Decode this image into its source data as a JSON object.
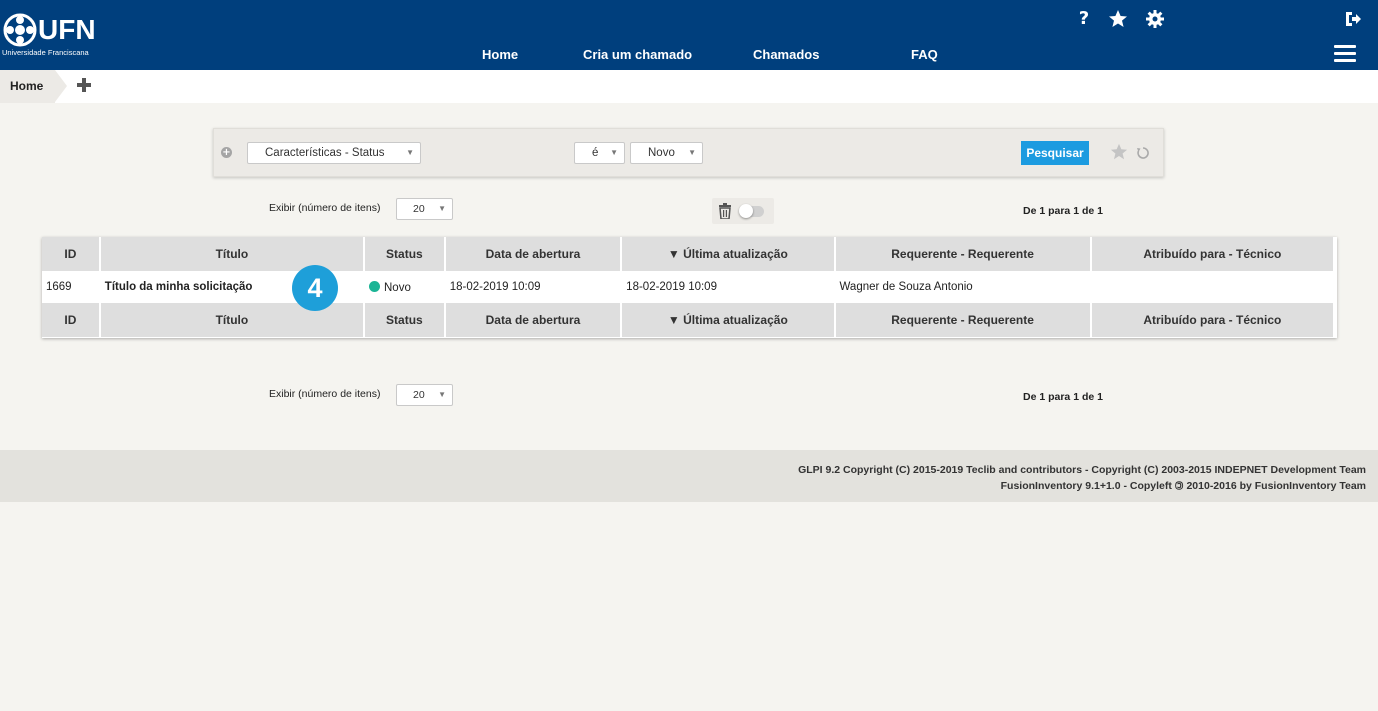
{
  "brand": {
    "name": "UFN",
    "subtitle": "Universidade Franciscana"
  },
  "header": {
    "icons": [
      "help-icon",
      "star-icon",
      "gear-icon",
      "logout-icon"
    ],
    "help_glyph": "?",
    "nav": [
      "Home",
      "Cria um chamado",
      "Chamados",
      "FAQ"
    ]
  },
  "breadcrumb": {
    "home": "Home"
  },
  "search": {
    "field": "Características - Status",
    "operator": "é",
    "value": "Novo",
    "button": "Pesquisar"
  },
  "pager": {
    "label": "Exibir (número de itens)",
    "per_page": "20",
    "count": "De 1 para 1 de 1"
  },
  "table": {
    "columns": [
      "ID",
      "Título",
      "Status",
      "Data de abertura",
      "▼ Última atualização",
      "Requerente - Requerente",
      "Atribuído para - Técnico"
    ],
    "rows": [
      {
        "id": "1669",
        "title": "Título da minha solicitação",
        "status": "Novo",
        "opened": "18-02-2019 10:09",
        "updated": "18-02-2019 10:09",
        "requester": "Wagner de Souza Antonio",
        "assigned": ""
      }
    ]
  },
  "annotation": {
    "step": "4"
  },
  "footer": {
    "line1": "GLPI 9.2 Copyright (C) 2015-2019 Teclib and contributors - Copyright (C) 2003-2015 INDEPNET Development Team",
    "line2": "FusionInventory 9.1+1.0 - Copyleft 🄯 2010-2016 by FusionInventory Team"
  },
  "colors": {
    "header_bg": "#003f7d",
    "accent": "#1c9be0",
    "status_new": "#1bb495"
  }
}
